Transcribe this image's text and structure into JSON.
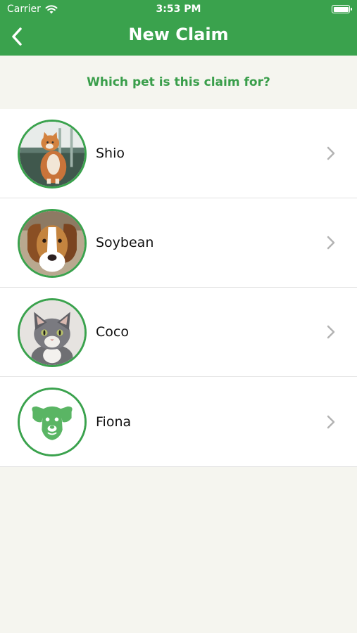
{
  "status_bar": {
    "carrier": "Carrier",
    "time": "3:53 PM"
  },
  "nav": {
    "title": "New Claim",
    "back_icon": "chevron-left-icon"
  },
  "prompt": "Which pet is this claim for?",
  "pets": [
    {
      "name": "Shio",
      "photo": "cat-orange-photo"
    },
    {
      "name": "Soybean",
      "photo": "beagle-photo"
    },
    {
      "name": "Coco",
      "photo": "kitten-gray-photo"
    },
    {
      "name": "Fiona",
      "photo": "dog-placeholder-icon"
    }
  ],
  "colors": {
    "brand": "#3aa24d",
    "background": "#f5f5ef"
  }
}
